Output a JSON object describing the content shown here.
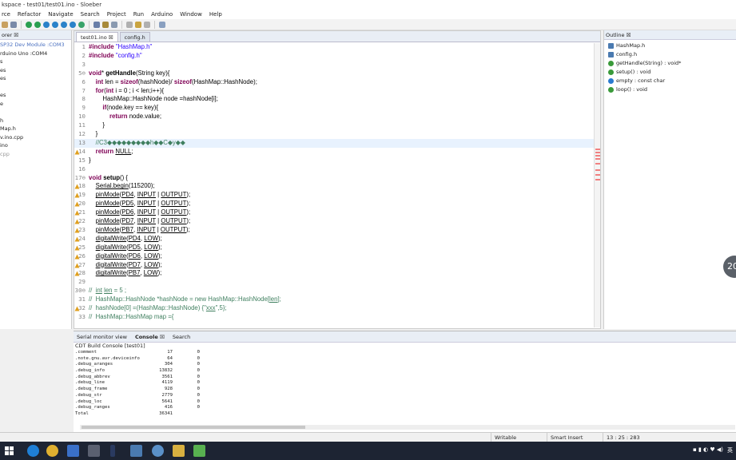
{
  "window": {
    "title": "kspace - test01/test01.ino - Sloeber"
  },
  "menu": [
    "rce",
    "Refactor",
    "Navigate",
    "Search",
    "Project",
    "Run",
    "Arduino",
    "Window",
    "Help"
  ],
  "explorer": {
    "tab_label": "orer ☒",
    "items": [
      "SP32 Dev Module :COM3",
      "rduino Uno :COM4",
      "s",
      "es",
      "es",
      "",
      "es",
      "e",
      "",
      "h",
      "Map.h",
      "v.ino.cpp",
      "ino",
      "cpp"
    ]
  },
  "editor": {
    "tabs": [
      {
        "label": "test01.ino ☒",
        "active": true
      },
      {
        "label": "config.h",
        "active": false
      }
    ],
    "lines": [
      {
        "n": "1",
        "html": "<span class='kw'>#include</span> <span class='str'>\"HashMap.h\"</span>"
      },
      {
        "n": "2",
        "html": "<span class='kw'>#include</span> <span class='str'>\"config.h\"</span>"
      },
      {
        "n": "3",
        "html": ""
      },
      {
        "n": "5⊖",
        "html": "<span class='kw'>void</span>* <b>getHandle</b>(String key){"
      },
      {
        "n": "6",
        "html": "    <span class='kw'>int</span> len = <span class='kw'>sizeof</span>(hashNode)/ <span class='kw'>sizeof</span>(HashMap::HashNode);"
      },
      {
        "n": "7",
        "html": "    <span class='kw'>for</span>(<span class='kw'>int</span> i = 0 ; i &lt; len;i++){"
      },
      {
        "n": "8",
        "html": "        HashMap::HashNode node =hashNode[i];"
      },
      {
        "n": "9",
        "html": "        <span class='kw'>if</span>(node.key == key){"
      },
      {
        "n": "10",
        "html": "            <span class='kw'>return</span> node.value;"
      },
      {
        "n": "11",
        "html": "        }"
      },
      {
        "n": "12",
        "html": "    }"
      },
      {
        "n": "13",
        "html": "    <span class='cm'>//C3◆◆◆◆◆◆◆◆◆h◆◆C◆y◆◆</span>"
      },
      {
        "n": "14",
        "html": "    <span class='kw'>return</span> <u>NULL</u>;"
      },
      {
        "n": "15",
        "html": "}"
      },
      {
        "n": "16",
        "html": ""
      },
      {
        "n": "17⊖",
        "html": "<span class='kw'>void</span> <b>setup</b>() {"
      },
      {
        "n": "18",
        "html": "    <u>Serial.begin</u>(115200);"
      },
      {
        "n": "19",
        "html": "    <u>pinMode</u>(<u>PD4</u>, <u>INPUT</u> | <u>OUTPUT</u>);"
      },
      {
        "n": "20",
        "html": "    <u>pinMode</u>(<u>PD5</u>, <u>INPUT</u> | <u>OUTPUT</u>);"
      },
      {
        "n": "21",
        "html": "    <u>pinMode</u>(<u>PD6</u>, <u>INPUT</u> | <u>OUTPUT</u>);"
      },
      {
        "n": "22",
        "html": "    <u>pinMode</u>(<u>PD7</u>, <u>INPUT</u> | <u>OUTPUT</u>);"
      },
      {
        "n": "23",
        "html": "    <u>pinMode</u>(<u>PB7</u>, <u>INPUT</u> | <u>OUTPUT</u>);"
      },
      {
        "n": "24",
        "html": "    <u>digitalWrite</u>(<u>PD4</u>, <u>LOW</u>);"
      },
      {
        "n": "25",
        "html": "    <u>digitalWrite</u>(<u>PD5</u>, <u>LOW</u>);"
      },
      {
        "n": "26",
        "html": "    <u>digitalWrite</u>(<u>PD6</u>, <u>LOW</u>);"
      },
      {
        "n": "27",
        "html": "    <u>digitalWrite</u>(<u>PD7</u>, <u>LOW</u>);"
      },
      {
        "n": "28",
        "html": "    <u>digitalWrite</u>(<u>PB7</u>, <u>LOW</u>);"
      },
      {
        "n": "29",
        "html": ""
      },
      {
        "n": "30⊖",
        "html": "<span class='cm'>//  <u>int</u> <u>len</u> = 5 ;</span>"
      },
      {
        "n": "31",
        "html": "<span class='cm'>//  HashMap::HashNode *hashNode = new HashMap::HashNode[<u>len</u>];</span>"
      },
      {
        "n": "32",
        "html": "<span class='cm'>//  hashNode[0] =(HashMap::HashNode) {\"<u>xxx</u>\",5};</span>"
      },
      {
        "n": "33",
        "html": "<span class='cm'>//  HashMap::HashMap map ={</span>"
      }
    ]
  },
  "outline": {
    "tab_label": "Outline ☒",
    "items": [
      {
        "label": "HashMap.h",
        "type": ""
      },
      {
        "label": "config.h",
        "type": ""
      },
      {
        "label": "getHandle(String) : void*",
        "type": ""
      },
      {
        "label": "setup() : void",
        "type": ""
      },
      {
        "label": "empty : const char",
        "type": ""
      },
      {
        "label": "loop() : void",
        "type": ""
      }
    ]
  },
  "console": {
    "tabs": [
      "Serial monitor view",
      "Console ☒",
      "Search"
    ],
    "title": "CDT Build Console [test01]",
    "rows": [
      [
        ".comment",
        "17",
        "0"
      ],
      [
        ".note.gnu.avr.deviceinfo",
        "64",
        "0"
      ],
      [
        ".debug_aranges",
        "304",
        "0"
      ],
      [
        ".debug_info",
        "13832",
        "0"
      ],
      [
        ".debug_abbrev",
        "3561",
        "0"
      ],
      [
        ".debug_line",
        "4119",
        "0"
      ],
      [
        ".debug_frame",
        "928",
        "0"
      ],
      [
        ".debug_str",
        "2779",
        "0"
      ],
      [
        ".debug_loc",
        "5641",
        "0"
      ],
      [
        ".debug_ranges",
        "416",
        "0"
      ],
      [
        "Total",
        "36341",
        ""
      ]
    ]
  },
  "status": {
    "writable": "Writable",
    "insert_mode": "Smart Insert",
    "position": "13 : 25 : 283"
  },
  "badge": {
    "text": "20"
  },
  "tray": {
    "ime": "英"
  }
}
